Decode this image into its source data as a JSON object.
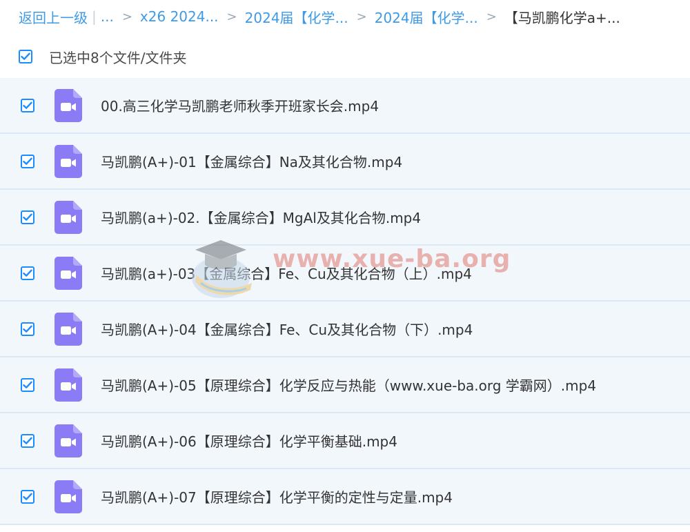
{
  "breadcrumb": {
    "back_label": "返回上一级",
    "ellipsis": "...",
    "items": [
      "x26 2024...",
      "2024届【化学...",
      "2024届【化学..."
    ],
    "current": "【马凯鹏化学a+...",
    "separator": ">"
  },
  "selection": {
    "label": "已选中8个文件/文件夹",
    "checked": true
  },
  "files": [
    {
      "name": "00.高三化学马凯鹏老师秋季开班家长会.mp4",
      "checked": true,
      "icon": "video-file-icon"
    },
    {
      "name": "马凯鹏(A+)-01【金属综合】Na及其化合物.mp4",
      "checked": true,
      "icon": "video-file-icon"
    },
    {
      "name": "马凯鹏(a+)-02.【金属综合】MgAl及其化合物.mp4",
      "checked": true,
      "icon": "video-file-icon"
    },
    {
      "name": "马凯鹏(a+)-03【金属综合】Fe、Cu及其化合物（上）.mp4",
      "checked": true,
      "icon": "video-file-icon"
    },
    {
      "name": "马凯鹏(A+)-04【金属综合】Fe、Cu及其化合物（下）.mp4",
      "checked": true,
      "icon": "video-file-icon"
    },
    {
      "name": "马凯鹏(A+)-05【原理综合】化学反应与热能（www.xue-ba.org 学霸网）.mp4",
      "checked": true,
      "icon": "video-file-icon"
    },
    {
      "name": "马凯鹏(A+)-06【原理综合】化学平衡基础.mp4",
      "checked": true,
      "icon": "video-file-icon"
    },
    {
      "name": "马凯鹏(A+)-07【原理综合】化学平衡的定性与定量.mp4",
      "checked": true,
      "icon": "video-file-icon"
    }
  ],
  "watermark": {
    "text": "www.xue-ba.org"
  },
  "colors": {
    "link": "#3f9ae6",
    "checkbox": "#1a8cff",
    "row_bg": "#f2f7fc",
    "row_border": "#dce9f5",
    "video_icon": "#8b7cf6"
  }
}
